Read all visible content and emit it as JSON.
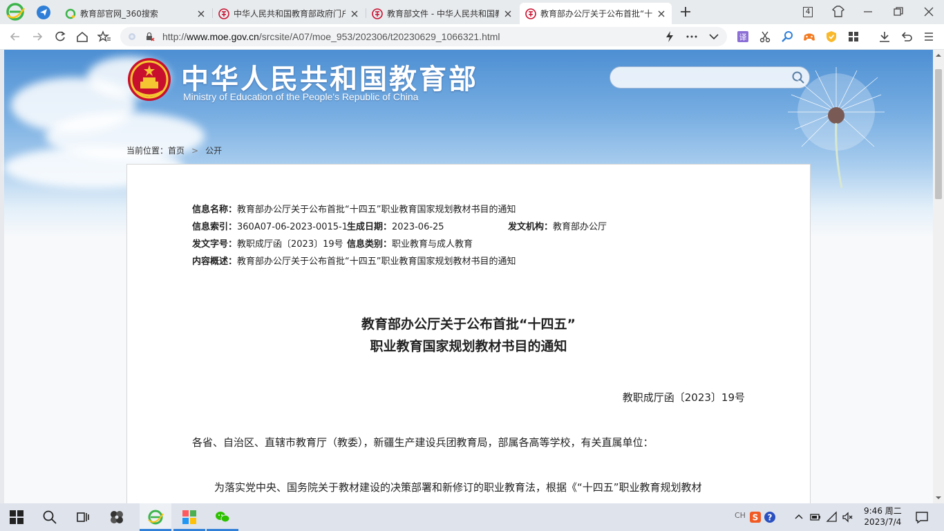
{
  "browser": {
    "tabs": [
      {
        "label": "教育部官网_360搜索",
        "active": false
      },
      {
        "label": "中华人民共和国教育部政府门户网站",
        "active": false
      },
      {
        "label": "教育部文件 - 中华人民共和国教育部",
        "active": false
      },
      {
        "label": "教育部办公厅关于公布首批“十四五”",
        "active": true
      }
    ],
    "tab_count": "4",
    "url_prefix": "http://",
    "url_host": "www.moe.gov.cn",
    "url_path": "/srcsite/A07/moe_953/202306/t20230629_1066321.html"
  },
  "site": {
    "title_cn": "中华人民共和国教育部",
    "title_en": "Ministry of Education of the People's Republic of China",
    "search_placeholder": ""
  },
  "breadcrumb": {
    "prefix": "当前位置：",
    "items": [
      "首页",
      "公开"
    ],
    "separator": ">"
  },
  "meta": {
    "name_label": "信息名称：",
    "name_value": "教育部办公厅关于公布首批“十四五”职业教育国家规划教材书目的通知",
    "index_label": "信息索引：",
    "index_value": "360A07-06-2023-0015-1",
    "date_label": "生成日期：",
    "date_value": "2023-06-25",
    "org_label": "发文机构：",
    "org_value": "教育部办公厅",
    "docno_label": "发文字号：",
    "docno_value": "教职成厅函〔2023〕19号",
    "category_label": "信息类别：",
    "category_value": "职业教育与成人教育",
    "summary_label": "内容概述：",
    "summary_value": "教育部办公厅关于公布首批“十四五”职业教育国家规划教材书目的通知"
  },
  "document": {
    "title_line1": "教育部办公厅关于公布首批“十四五”",
    "title_line2": "职业教育国家规划教材书目的通知",
    "doc_number": "教职成厅函〔2023〕19号",
    "salutation": "各省、自治区、直辖市教育厅（教委），新疆生产建设兵团教育局，部属各高等学校，有关直属单位：",
    "para1_start": "为落实党中央、国务院关于教材建设的决策部署和新修订的职业教育法，根据《“十四五”职业教育规划教材"
  },
  "taskbar": {
    "time": "9:46 周二",
    "date": "2023/7/4",
    "ime": "CH"
  },
  "colors": {
    "accent": "#2f7fd8",
    "sky_top": "#4d8fd3"
  }
}
